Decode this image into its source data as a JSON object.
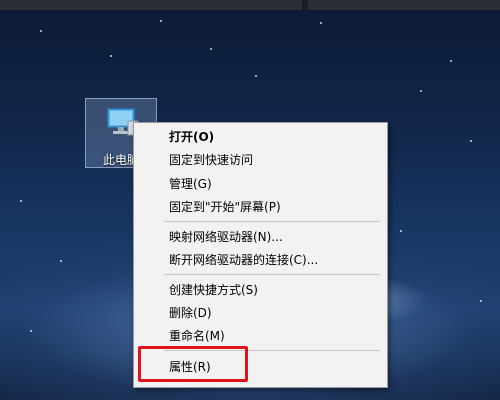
{
  "desktop": {
    "icon_label": "此电脑",
    "icon_name": "computer-icon"
  },
  "context_menu": {
    "items": [
      {
        "label": "打开(O)",
        "bold": true
      },
      {
        "label": "固定到快速访问"
      },
      {
        "label": "管理(G)"
      },
      {
        "label": "固定到\"开始\"屏幕(P)"
      },
      {
        "label": "映射网络驱动器(N)..."
      },
      {
        "label": "断开网络驱动器的连接(C)..."
      },
      {
        "label": "创建快捷方式(S)"
      },
      {
        "label": "删除(D)"
      },
      {
        "label": "重命名(M)"
      },
      {
        "label": "属性(R)",
        "highlighted": true
      }
    ]
  },
  "colors": {
    "highlight_border": "#e0141c",
    "menu_background": "#f2f2f2"
  }
}
